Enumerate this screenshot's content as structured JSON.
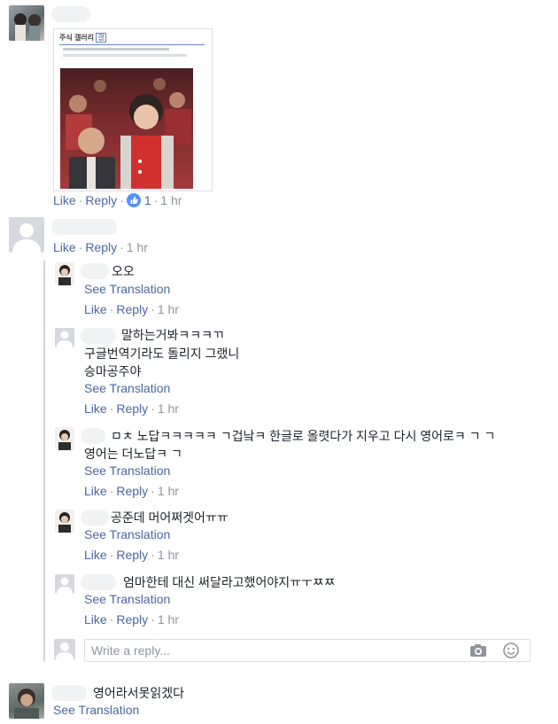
{
  "actions": {
    "like": "Like",
    "reply": "Reply",
    "sep": "·"
  },
  "comments": [
    {
      "id": "c1",
      "image_header": "주식 갤러리",
      "image_header_badge": "갤",
      "reaction_count": "1",
      "time": "1 hr"
    },
    {
      "id": "c2",
      "time": "1 hr",
      "replies": [
        {
          "text": "오오",
          "see_translation": "See Translation",
          "time": "1 hr"
        },
        {
          "text_lines": [
            "말하는거봐ㅋㅋㅋㄲ",
            "구글번역기라도 돌리지 그랬니",
            "승마공주야"
          ],
          "see_translation": "See Translation",
          "time": "1 hr"
        },
        {
          "text_lines": [
            "ㅁㅊ 노답ㅋㅋㅋㅋㅋ ㄱ겁낰ㅋ 한글로 올렷다가 지우고 다시 영어로ㅋ ㄱ ㄱ",
            "영어는 더노답ㅋ ㄱ"
          ],
          "see_translation": "See Translation",
          "time": "1 hr"
        },
        {
          "text": "공준데 머어쩌겟어ㅠㅠ",
          "see_translation": "See Translation",
          "time": "1 hr"
        },
        {
          "text": "엄마한테 대신 써달라고했어야지ㅠㅜㅉㅉ",
          "see_translation": "See Translation",
          "time": "1 hr"
        }
      ],
      "reply_placeholder": "Write a reply..."
    },
    {
      "id": "c3",
      "text": "영어라서못읽겠다",
      "see_translation": "See Translation"
    }
  ],
  "colors": {
    "link": "#4b67a1",
    "meta": "#90949c",
    "like_badge": "#5890ff"
  },
  "icons": [
    "like-reaction-icon",
    "camera-icon",
    "smiley-icon",
    "default-avatar-icon"
  ]
}
